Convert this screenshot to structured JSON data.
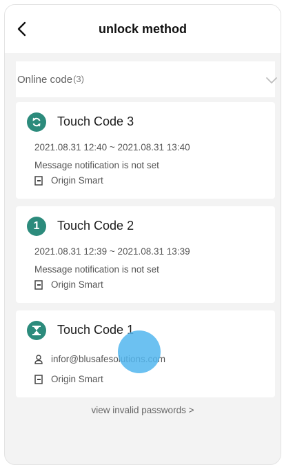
{
  "header": {
    "title": "unlock method"
  },
  "section": {
    "label": "Online code",
    "count": "(3)"
  },
  "cards": [
    {
      "title": "Touch Code 3",
      "validity": "2021.08.31 12:40 ~ 2021.08.31 13:40",
      "notification": "Message notification is not set",
      "device": "Origin Smart",
      "icon": "refresh-icon"
    },
    {
      "title": "Touch Code 2",
      "validity": "2021.08.31 12:39 ~ 2021.08.31 13:39",
      "notification": "Message notification is not set",
      "device": "Origin Smart",
      "icon": "one-icon",
      "icon_text": "1"
    },
    {
      "title": "Touch Code 1",
      "user": "infor@blusafesolutions.com",
      "device": "Origin Smart",
      "icon": "hourglass-icon"
    }
  ],
  "footer": {
    "label": "view invalid passwords  >"
  },
  "colors": {
    "accent": "#2c8b7c",
    "touch_indicator": "#52b6ee"
  }
}
